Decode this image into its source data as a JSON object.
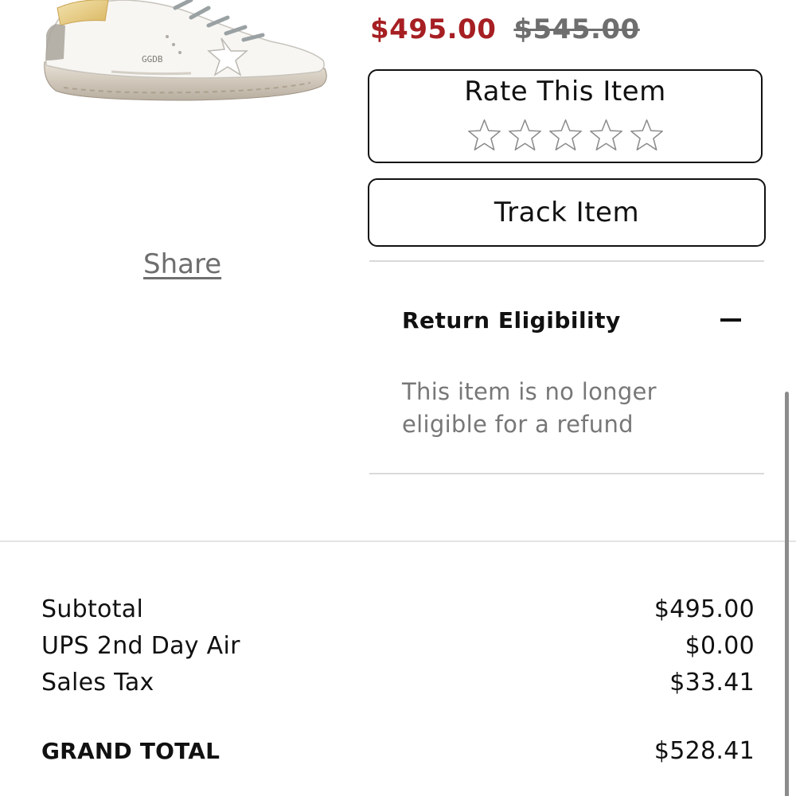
{
  "product": {
    "image_icon": "sneaker-image",
    "sale_price": "$495.00",
    "original_price": "$545.00",
    "sale_color": "#a61f23"
  },
  "rating": {
    "title": "Rate This Item",
    "max_stars": 5,
    "selected_stars": 0
  },
  "track": {
    "label": "Track Item"
  },
  "share": {
    "label": "Share"
  },
  "return_eligibility": {
    "title": "Return Eligibility",
    "expanded_icon": "minus-icon",
    "message": "This item is no longer eligible for a refund"
  },
  "totals": {
    "rows": [
      {
        "label": "Subtotal",
        "value": "$495.00"
      },
      {
        "label": "UPS 2nd Day Air",
        "value": "$0.00"
      },
      {
        "label": "Sales Tax",
        "value": "$33.41"
      }
    ],
    "grand_total_label": "GRAND TOTAL",
    "grand_total_value": "$528.41"
  }
}
